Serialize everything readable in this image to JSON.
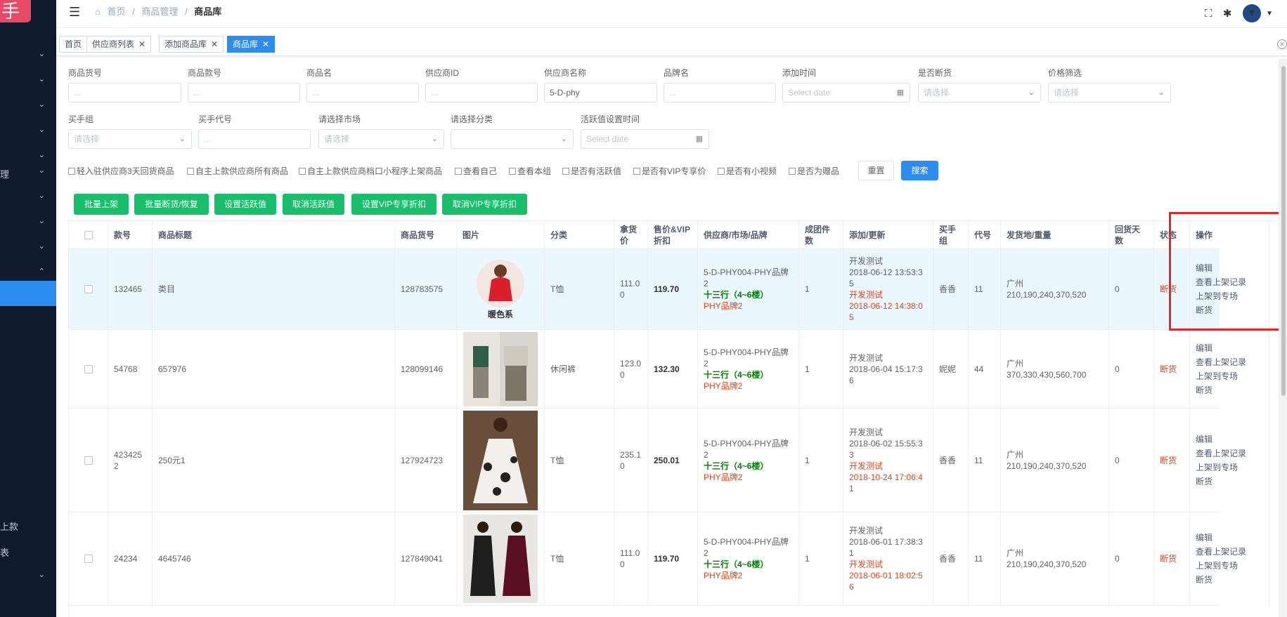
{
  "sidebar": {
    "logo": "手",
    "items": [
      {
        "label": "",
        "chev": "⌄"
      },
      {
        "label": "",
        "chev": "⌄"
      },
      {
        "label": "",
        "chev": "⌄"
      },
      {
        "label": "",
        "chev": "⌄"
      },
      {
        "label": "",
        "chev": "⌄"
      },
      {
        "label": "理",
        "chev": "⌄"
      },
      {
        "label": "",
        "chev": "⌄"
      },
      {
        "label": "",
        "chev": "⌄"
      },
      {
        "label": "",
        "chev": "⌄"
      },
      {
        "label": "",
        "chev": "⌃"
      }
    ],
    "bottom_items": [
      {
        "label": "上款"
      },
      {
        "label": "表"
      },
      {
        "label": "",
        "chev": "⌄"
      }
    ]
  },
  "header": {
    "menu_icon": "☰",
    "home_icon": "⌂",
    "breadcrumb": [
      "首页",
      "商品管理",
      "商品库"
    ],
    "icons": [
      "fullscreen-icon",
      "bug-icon",
      "avatar"
    ]
  },
  "tabs": [
    {
      "label": "首页",
      "closable": false
    },
    {
      "label": "供应商列表",
      "closable": true
    },
    {
      "label": "添加商品库",
      "closable": true
    },
    {
      "label": "商品库",
      "closable": true,
      "active": true
    }
  ],
  "filters": {
    "row1": [
      {
        "label": "商品货号",
        "placeholder": "...",
        "value": ""
      },
      {
        "label": "商品款号",
        "placeholder": "...",
        "value": ""
      },
      {
        "label": "商品名",
        "placeholder": "...",
        "value": ""
      },
      {
        "label": "供应商ID",
        "placeholder": "...",
        "value": ""
      },
      {
        "label": "供应商名称",
        "placeholder": "...",
        "value": "5-D-phy"
      },
      {
        "label": "品牌名",
        "placeholder": "...",
        "value": ""
      },
      {
        "label": "添加时间",
        "placeholder": "Select date",
        "value": ""
      },
      {
        "label": "是否断货",
        "placeholder": "请选择",
        "value": ""
      },
      {
        "label": "价格筛选",
        "placeholder": "请选择",
        "value": ""
      }
    ],
    "row2": [
      {
        "label": "买手组",
        "placeholder": "请选择",
        "value": ""
      },
      {
        "label": "买手代号",
        "placeholder": "...",
        "value": ""
      },
      {
        "label": "请选择市场",
        "placeholder": "请选择",
        "value": ""
      },
      {
        "label": "请选择分类",
        "placeholder": "",
        "value": ""
      },
      {
        "label": "活跃值设置时间",
        "placeholder": "Select date",
        "value": ""
      }
    ],
    "checkboxes": [
      "轻入驻供应商3天回货商品",
      "自主上款供应商所有商品",
      "自主上款供应商档口小程序上架商品",
      "查看自己",
      "查看本组",
      "是否有活跃值",
      "是否有VIP专享价",
      "是否有小视频",
      "是否为赠品"
    ],
    "reset_label": "重置",
    "search_label": "搜索"
  },
  "actions": [
    "批量上架",
    "批量断货/恢复",
    "设置活跃值",
    "取消活跃值",
    "设置VIP专享折扣",
    "取消VIP专享折扣"
  ],
  "table": {
    "headers": [
      "",
      "款号",
      "商品标题",
      "商品货号",
      "图片",
      "分类",
      "拿货价",
      "售价&VIP折扣",
      "供应商/市场/品牌",
      "成团件数",
      "添加/更新",
      "买手组",
      "代号",
      "发货地/重量",
      "回货天数",
      "状态",
      "操作"
    ],
    "rows": [
      {
        "code": "132465",
        "title": "类目",
        "sku": "128783575",
        "img_caption": "暖色系",
        "category": "T恤",
        "cost": "111.00",
        "price": "119.70",
        "supplier": "5-D-PHY004-PHY品牌2",
        "market": "十三行（4~6楼）",
        "brand": "PHY品牌2",
        "min": "1",
        "add_by": "开发测试",
        "add_time": "2018-06-12 13:53:35",
        "upd_by": "开发测试",
        "upd_time": "2018-06-12 14:38:05",
        "group": "香香",
        "buyer": "11",
        "ship": "广州",
        "weight": "210,190,240,370,520",
        "days": "0",
        "status": "断货",
        "ops": [
          "编辑",
          "查看上架记录",
          "上架到专场",
          "断货"
        ]
      },
      {
        "code": "54768",
        "title": "657976",
        "sku": "128099146",
        "img_caption": "",
        "category": "休闲裤",
        "cost": "123.00",
        "price": "132.30",
        "supplier": "5-D-PHY004-PHY品牌2",
        "market": "十三行（4~6楼）",
        "brand": "PHY品牌2",
        "min": "1",
        "add_by": "开发测试",
        "add_time": "2018-06-04 15:17:36",
        "upd_by": "",
        "upd_time": "",
        "group": "妮妮",
        "buyer": "44",
        "ship": "广州",
        "weight": "370,330,430,560,700",
        "days": "0",
        "status": "断货",
        "ops": [
          "编辑",
          "查看上架记录",
          "上架到专场",
          "断货"
        ]
      },
      {
        "code": "4234252",
        "title": "250元1",
        "sku": "127924723",
        "img_caption": "",
        "category": "T恤",
        "cost": "235.10",
        "price": "250.01",
        "supplier": "5-D-PHY004-PHY品牌2",
        "market": "十三行（4~6楼）",
        "brand": "PHY品牌2",
        "min": "1",
        "add_by": "开发测试",
        "add_time": "2018-06-02 15:55:33",
        "upd_by": "开发测试",
        "upd_time": "2018-10-24 17:06:41",
        "group": "香香",
        "buyer": "11",
        "ship": "广州",
        "weight": "210,190,240,370,520",
        "days": "0",
        "status": "断货",
        "ops": [
          "编辑",
          "查看上架记录",
          "上架到专场",
          "断货"
        ]
      },
      {
        "code": "24234",
        "title": "4645746",
        "sku": "127849041",
        "img_caption": "",
        "category": "T恤",
        "cost": "111.00",
        "price": "119.70",
        "supplier": "5-D-PHY004-PHY品牌2",
        "market": "十三行（4~6楼）",
        "brand": "PHY品牌2",
        "min": "1",
        "add_by": "开发测试",
        "add_time": "2018-06-01 17:38:31",
        "upd_by": "开发测试",
        "upd_time": "2018-06-01 18:02:56",
        "group": "香香",
        "buyer": "11",
        "ship": "广州",
        "weight": "210,190,240,370,520",
        "days": "0",
        "status": "断货",
        "ops": [
          "编辑",
          "查看上架记录",
          "上架到专场",
          "断货"
        ]
      }
    ]
  },
  "colors": {
    "sidebar": "#0f1b2d",
    "primary": "#2d8cf0",
    "success": "#19be6b",
    "danger": "#ed4014",
    "highlight_box": "#e8262a"
  }
}
